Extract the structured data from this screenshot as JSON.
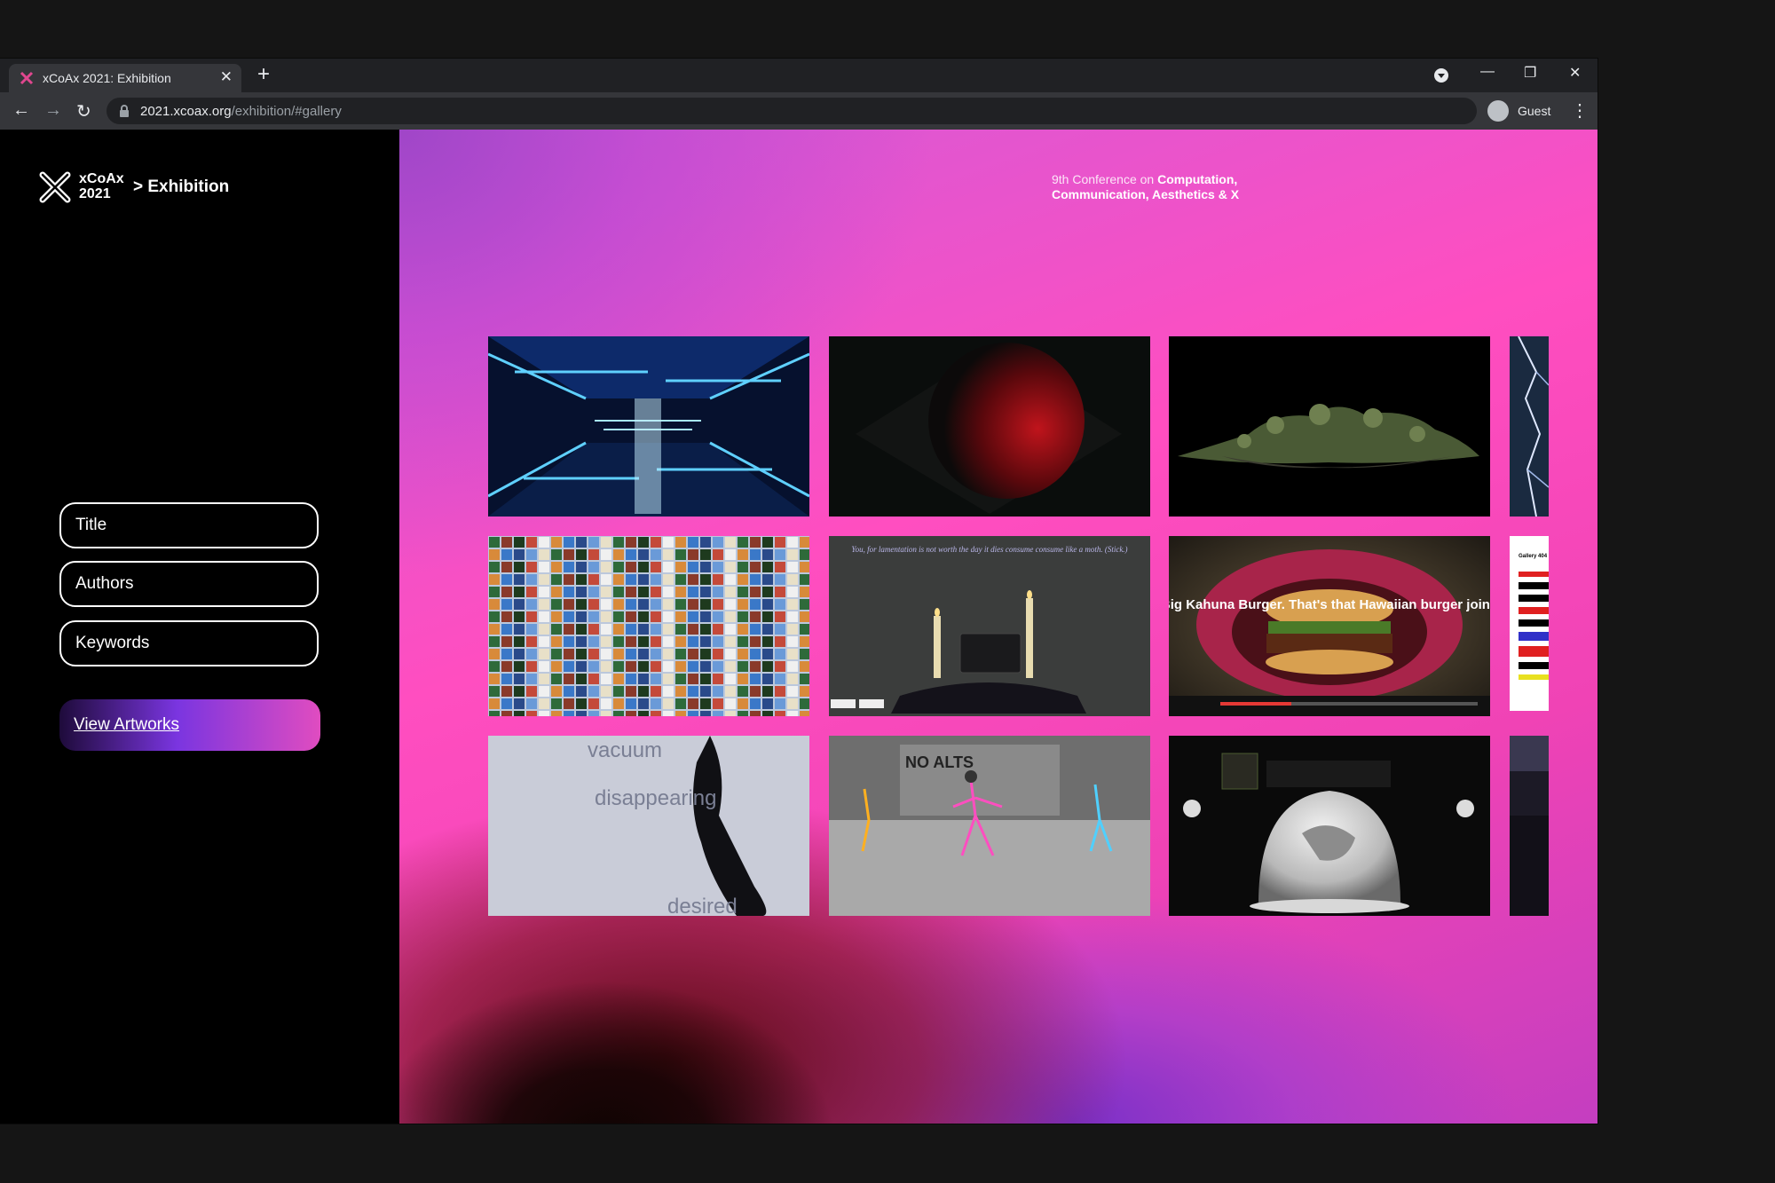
{
  "browser": {
    "tab_title": "xCoAx 2021: Exhibition",
    "url_host": "2021.xcoax.org",
    "url_path": "/exhibition/#gallery",
    "profile_label": "Guest"
  },
  "sidebar": {
    "logo_line1": "xCoAx",
    "logo_line2": "2021",
    "breadcrumb": "> Exhibition",
    "filters": [
      "Title",
      "Authors",
      "Keywords"
    ],
    "view_button": "View Artworks"
  },
  "header": {
    "conf_line1_plain": "9th Conference on ",
    "conf_line1_bold": "Computation,",
    "conf_line2_bold": "Communication, Aesthetics & X"
  },
  "gallery": {
    "thumb_texts": {
      "candles_quote": "You, for lamentation is not worth the day it dies consume consume like a moth. (Stick.)",
      "burger_quote": "Big Kahuna Burger. That's that Hawaiian burger joint.",
      "vacuum_word": "vacuum",
      "disappearing_word": "disappearing",
      "desired_word": "desired",
      "street_sign": "NO ALTS",
      "gallery_label": "Gallery 404"
    }
  },
  "colors": {
    "accent_pink": "#ff4ec0",
    "accent_purple": "#7a35e0",
    "sidebar_bg": "#000000"
  }
}
